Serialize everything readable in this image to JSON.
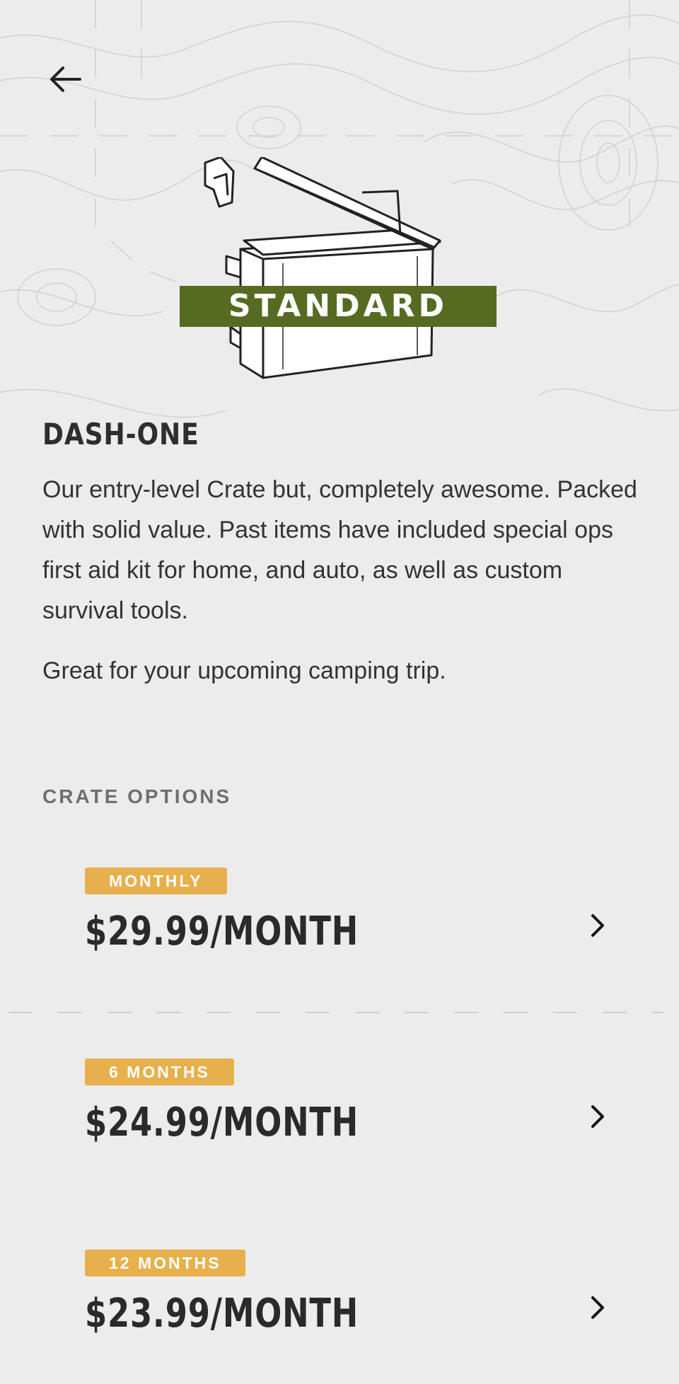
{
  "product": {
    "badge": "STANDARD",
    "name": "DASH-ONE",
    "description": "Our entry-level Crate but, completely awesome. Packed with solid value. Past items have included special ops first aid kit for home, and auto, as well as custom survival tools.",
    "tagline": "Great for your upcoming camping trip."
  },
  "options": {
    "heading": "CRATE OPTIONS",
    "items": [
      {
        "tag": "MONTHLY",
        "price": "$29.99/MONTH"
      },
      {
        "tag": "6 MONTHS",
        "price": "$24.99/MONTH"
      },
      {
        "tag": "12 MONTHS",
        "price": "$23.99/MONTH"
      }
    ]
  },
  "theme": {
    "background": "#ececec",
    "badge_green": "#556b22",
    "tag_gold": "#e8b04c",
    "text_dark": "#2b2b2b",
    "text_muted": "#6f6f6f"
  },
  "icons": {
    "back": "arrow-left-icon",
    "chevron": "chevron-right-icon",
    "hero": "ammo-crate-illustration"
  }
}
